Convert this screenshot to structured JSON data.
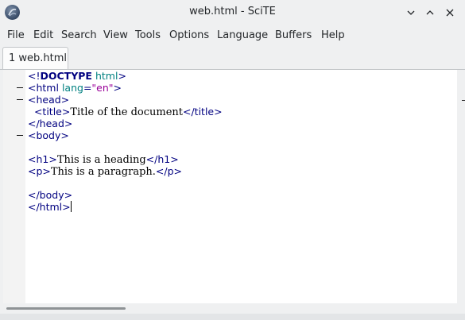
{
  "window": {
    "title": "web.html - SciTE"
  },
  "menubar": {
    "items": [
      "File",
      "Edit",
      "Search",
      "View",
      "Tools",
      "Options",
      "Language",
      "Buffers",
      "Help"
    ]
  },
  "tabs": [
    {
      "label": "1 web.html"
    }
  ],
  "editor": {
    "lines": {
      "l1": {
        "open": "<!",
        "kw": "DOCTYPE",
        "sp": " ",
        "ident": "html",
        "close": ">"
      },
      "l2": {
        "open": "<html",
        "sp": " ",
        "attr": "lang",
        "eq": "=",
        "val": "\"en\"",
        "close": ">"
      },
      "l3": {
        "tag": "<head>"
      },
      "l4": {
        "indent": "  ",
        "open": "<title>",
        "text": "Title of the document",
        "close": "</title>"
      },
      "l5": {
        "tag": "</head>"
      },
      "l6": {
        "tag": "<body>"
      },
      "l8": {
        "open": "<h1>",
        "text": "This is a heading",
        "close": "</h1>"
      },
      "l9": {
        "open": "<p>",
        "text": "This is a paragraph.",
        "close": "</p>"
      },
      "l11": {
        "tag": "</body>"
      },
      "l12": {
        "tag": "</html>"
      }
    }
  },
  "colors": {
    "tag": "#000080",
    "attribute": "#008080",
    "string": "#990099",
    "text": "#000000",
    "margin": "#f3f3f3"
  }
}
